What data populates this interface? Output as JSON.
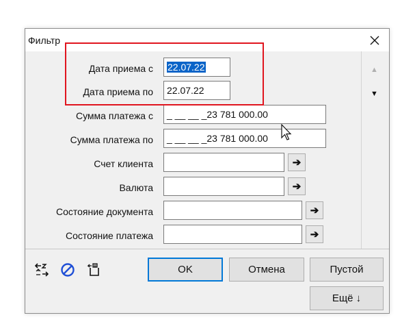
{
  "dialog": {
    "title": "Фильтр",
    "close_glyph": "✕"
  },
  "fields": [
    {
      "label": "Дата приема с",
      "value": "22.07.22",
      "selected": true
    },
    {
      "label": "Дата приема по",
      "value": "22.07.22"
    },
    {
      "label": "Сумма платежа с",
      "value": "_ __ __ _23 781 000.00"
    },
    {
      "label": "Сумма платежа по",
      "value": "_ __ __ _23 781 000.00"
    },
    {
      "label": "Счет клиента",
      "value": ""
    },
    {
      "label": "Валюта",
      "value": ""
    },
    {
      "label": "Состояние документа",
      "value": ""
    },
    {
      "label": "Состояние платежа",
      "value": ""
    }
  ],
  "arrow_glyph": "➔",
  "scroll": {
    "up_glyph": "▲",
    "down_glyph": "▼"
  },
  "buttons": {
    "ok": "OK",
    "cancel": "Отмена",
    "empty": "Пустой",
    "more": "Ещё ↓"
  },
  "toolbar_icons": [
    "swap-icon",
    "cancel-circle-icon",
    "clipboard-icon"
  ],
  "colors": {
    "highlight": "#e0141e",
    "selection": "#0a64c8",
    "focus_border": "#0078d7",
    "cancel_icon": "#1f4fd6"
  }
}
